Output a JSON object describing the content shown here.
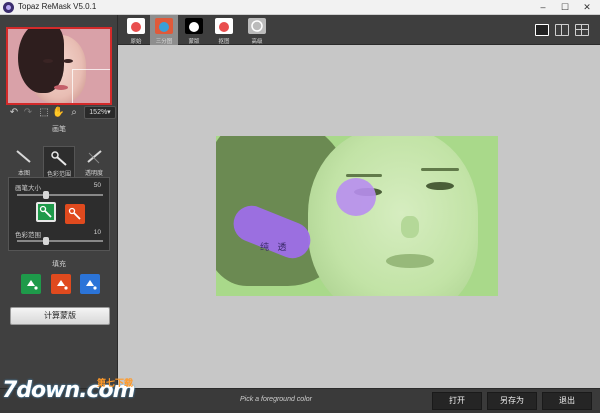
{
  "window": {
    "title": "Topaz ReMask V5.0.1",
    "controls": [
      "–",
      "☐",
      "✕"
    ]
  },
  "left_panel": {
    "zoom_value": "152%▾",
    "brush_section_title": "画笔",
    "brush_tabs": [
      {
        "label": "本图",
        "icon": "brush-icon"
      },
      {
        "label": "色彩范围",
        "icon": "color-range-brush-icon"
      },
      {
        "label": "透明度",
        "icon": "transparency-brush-icon"
      }
    ],
    "brush_size_label": "画笔大小",
    "brush_size_value": "50",
    "brush_size_fraction": 0.32,
    "color_range_label": "色彩范围",
    "color_range_value": "10",
    "color_range_fraction": 0.32,
    "fill_section_title": "填充",
    "compute_button": "计算蒙版"
  },
  "top_toolbar": {
    "view_tabs": [
      {
        "label": "原始",
        "color": "#e94e4e",
        "active": false
      },
      {
        "label": "三分图",
        "color": "#3a8a3a",
        "active": true
      },
      {
        "label": "蒙版",
        "color": "#000000",
        "active": false
      },
      {
        "label": "抠图",
        "color": "#e94e4e",
        "active": false
      },
      {
        "label": "高级",
        "color": "#bbbbbb",
        "active": false
      }
    ]
  },
  "canvas": {
    "overlay_text": "纯 透"
  },
  "status": {
    "hint": "Pick a foreground color",
    "open_button": "打开",
    "save_as_button": "另存为",
    "exit_button": "退出"
  },
  "watermark": {
    "main": "7down.com",
    "cn": "第七下载"
  }
}
